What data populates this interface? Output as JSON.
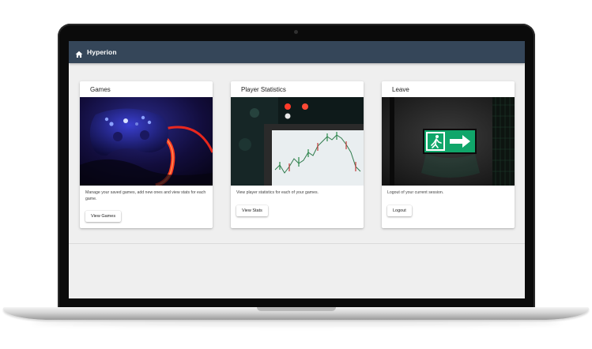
{
  "app": {
    "title": "Hyperion"
  },
  "cards": [
    {
      "title": "Games",
      "description": "Manage your saved games, add new ones and view stats for each game.",
      "button": "View Games",
      "image": "gamepad-with-red-neon-light"
    },
    {
      "title": "Player Statistics",
      "description": "View player statistics for each of your games.",
      "button": "View Stats",
      "image": "candlestick-chart-on-monitor"
    },
    {
      "title": "Leave",
      "description": "Logout of your current session.",
      "button": "Logout",
      "image": "green-exit-sign"
    }
  ],
  "colors": {
    "appbar": "#354659",
    "background": "#efefef",
    "exit_sign": "#10a66a"
  }
}
